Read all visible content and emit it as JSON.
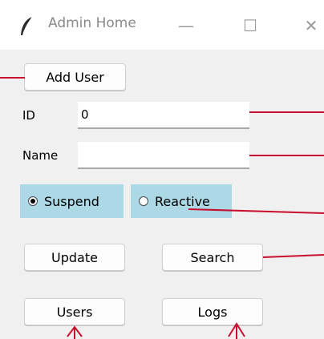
{
  "window": {
    "title": "Admin Home",
    "minimize_glyph": "—",
    "maximize_glyph": "☐",
    "close_glyph": "✕",
    "app_icon": "feather-icon"
  },
  "form": {
    "add_user_label": "Add User",
    "id_label": "ID",
    "id_value": "0",
    "name_label": "Name",
    "name_value": "",
    "suspend_label": "Suspend",
    "suspend_checked": true,
    "reactive_label": "Reactive",
    "reactive_checked": false,
    "update_label": "Update",
    "search_label": "Search",
    "users_label": "Users",
    "logs_label": "Logs"
  },
  "colors": {
    "radio_background": "#add8e6",
    "annotation_red": "#c8102e",
    "client_background": "#f0f0f0"
  }
}
